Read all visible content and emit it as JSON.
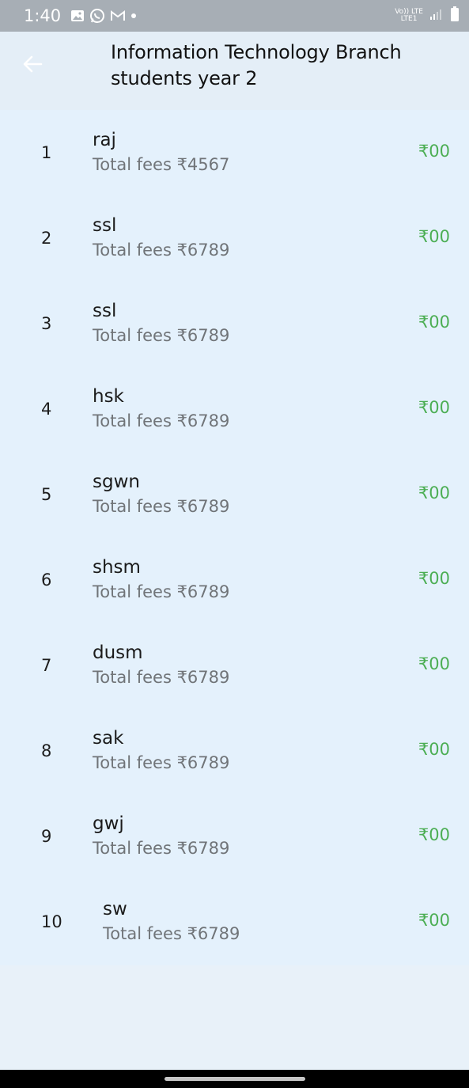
{
  "status_bar": {
    "time": "1:40",
    "icons": [
      "gallery-icon",
      "whatsapp-icon",
      "gmail-icon",
      "dot-icon"
    ],
    "network_top": "Vo)) LTE",
    "network_bottom": "LTE1"
  },
  "app_bar": {
    "title": "Information Technology Branch students year 2"
  },
  "students": [
    {
      "index": "1",
      "name": "raj",
      "fees": "Total fees ₹4567",
      "amount": "₹00"
    },
    {
      "index": "2",
      "name": "ssl",
      "fees": "Total fees ₹6789",
      "amount": "₹00"
    },
    {
      "index": "3",
      "name": "ssl",
      "fees": "Total fees ₹6789",
      "amount": "₹00"
    },
    {
      "index": "4",
      "name": "hsk",
      "fees": "Total fees ₹6789",
      "amount": "₹00"
    },
    {
      "index": "5",
      "name": "sgwn",
      "fees": "Total fees ₹6789",
      "amount": "₹00"
    },
    {
      "index": "6",
      "name": "shsm",
      "fees": "Total fees ₹6789",
      "amount": "₹00"
    },
    {
      "index": "7",
      "name": "dusm",
      "fees": "Total fees ₹6789",
      "amount": "₹00"
    },
    {
      "index": "8",
      "name": "sak",
      "fees": "Total fees ₹6789",
      "amount": "₹00"
    },
    {
      "index": "9",
      "name": "gwj",
      "fees": "Total fees ₹6789",
      "amount": "₹00"
    },
    {
      "index": "10",
      "name": "sw",
      "fees": "Total fees ₹6789",
      "amount": "₹00"
    }
  ],
  "colors": {
    "status_bar": "#a7aeb5",
    "list_background": "#e4f1fc",
    "amount": "#4cae54"
  }
}
